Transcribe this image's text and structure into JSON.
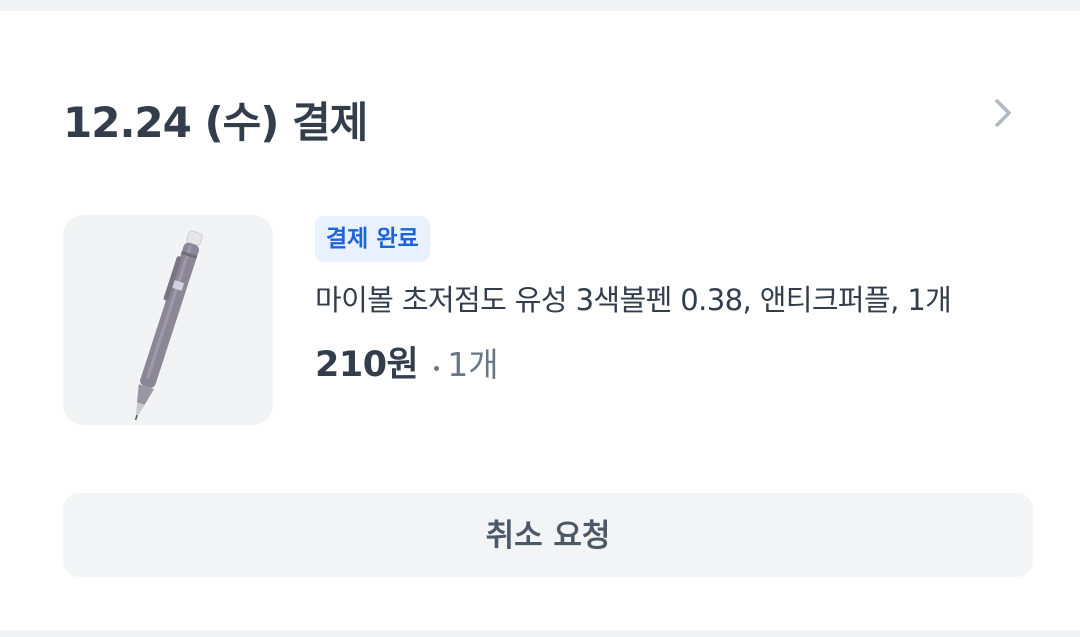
{
  "order": {
    "title": "12.24 (수) 결제"
  },
  "item": {
    "status_badge": "결제 완료",
    "name": "마이볼 초저점도 유성 3색볼펜 0.38, 앤티크퍼플, 1개",
    "price": "210원",
    "quantity": "1개",
    "image": "pen-image"
  },
  "actions": {
    "cancel_label": "취소 요청"
  },
  "icons": {
    "detail": "chevron-right-icon"
  },
  "colors": {
    "badge_text": "#1b64da",
    "badge_bg": "#e8f1fd",
    "title_text": "#333d4b",
    "secondary_text": "#6b7684",
    "button_bg": "#f2f4f6"
  }
}
